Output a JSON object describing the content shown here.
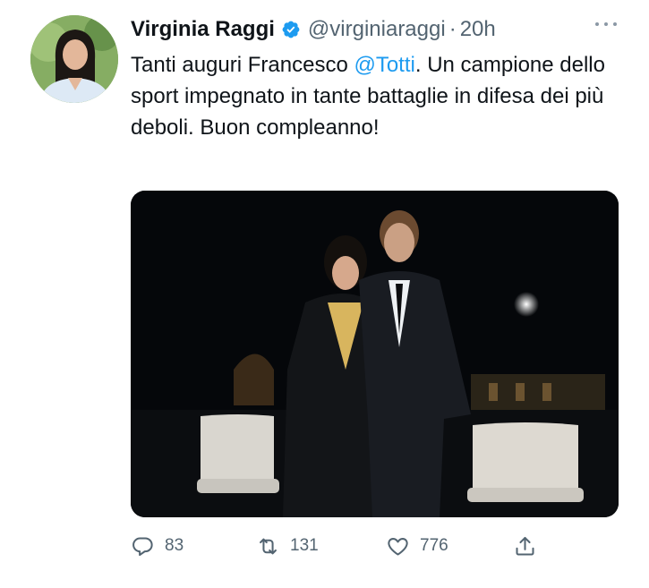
{
  "tweet": {
    "author_name": "Virginia Raggi",
    "handle": "@virginiaraggi",
    "separator": "·",
    "time": "20h",
    "text_before": "Tanti auguri Francesco ",
    "mention": "@Totti",
    "text_after": ". Un campione dello sport impegnato in tante battaglie in difesa dei più deboli. Buon compleanno!"
  },
  "actions": {
    "reply_count": "83",
    "retweet_count": "131",
    "like_count": "776"
  },
  "icons": {
    "verified": "verified-badge-icon",
    "more": "more-options-icon",
    "reply": "reply-icon",
    "retweet": "retweet-icon",
    "like": "heart-icon",
    "share": "share-icon"
  },
  "colors": {
    "accent": "#1d9bf0",
    "text": "#0f1419",
    "secondary": "#536471"
  }
}
